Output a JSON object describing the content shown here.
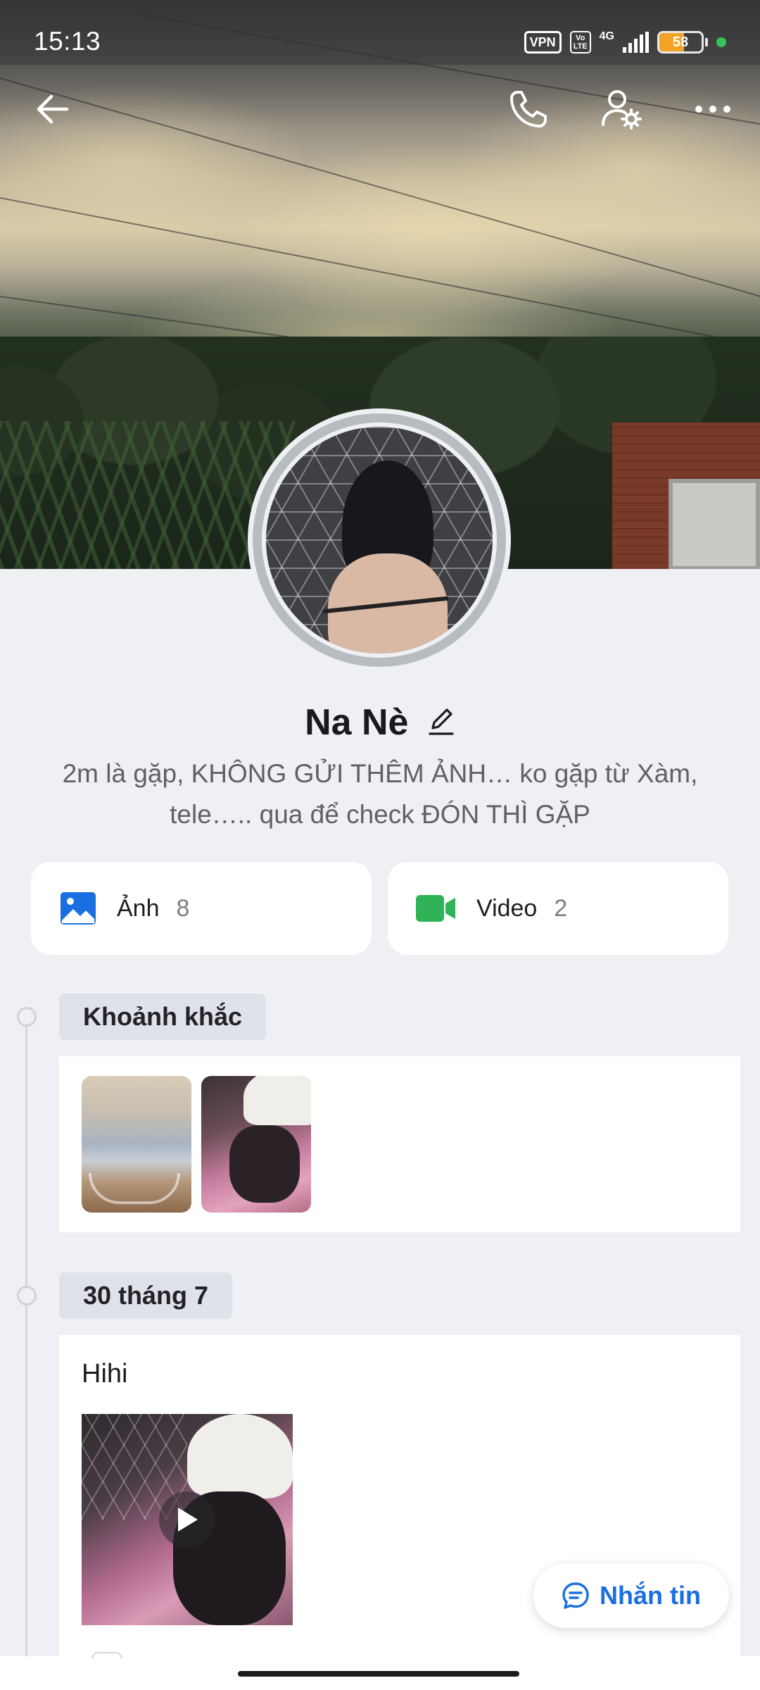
{
  "status_bar": {
    "time": "15:13",
    "vpn_label": "VPN",
    "volte_label": "Vo\nLTE",
    "network_label": "4G",
    "battery_level": "58",
    "battery_fraction": 0.58,
    "battery_color": "#f2a324",
    "dot_color": "#36c45a"
  },
  "top_bar": {
    "back_icon": "arrow-left-icon",
    "call_icon": "phone-icon",
    "settings_icon": "user-settings-icon",
    "more_icon": "more-horizontal-icon"
  },
  "profile": {
    "name": "Na Nè",
    "bio": "2m là gặp, KHÔNG GỬI THÊM ẢNH… ko gặp từ Xàm, tele….. qua để check ĐÓN THÌ GẶP"
  },
  "media": {
    "photos": {
      "label": "Ảnh",
      "count": "8",
      "icon": "image-icon",
      "color": "#1a6fe0"
    },
    "videos": {
      "label": "Video",
      "count": "2",
      "icon": "video-camera-icon",
      "color": "#2fb356"
    }
  },
  "timeline": {
    "moments_label": "Khoảnh khắc",
    "date_label": "30 tháng 7",
    "post_text": "Hihi"
  },
  "actions": {
    "message_label": "Nhắn tin",
    "message_color": "#1a6fe0"
  }
}
